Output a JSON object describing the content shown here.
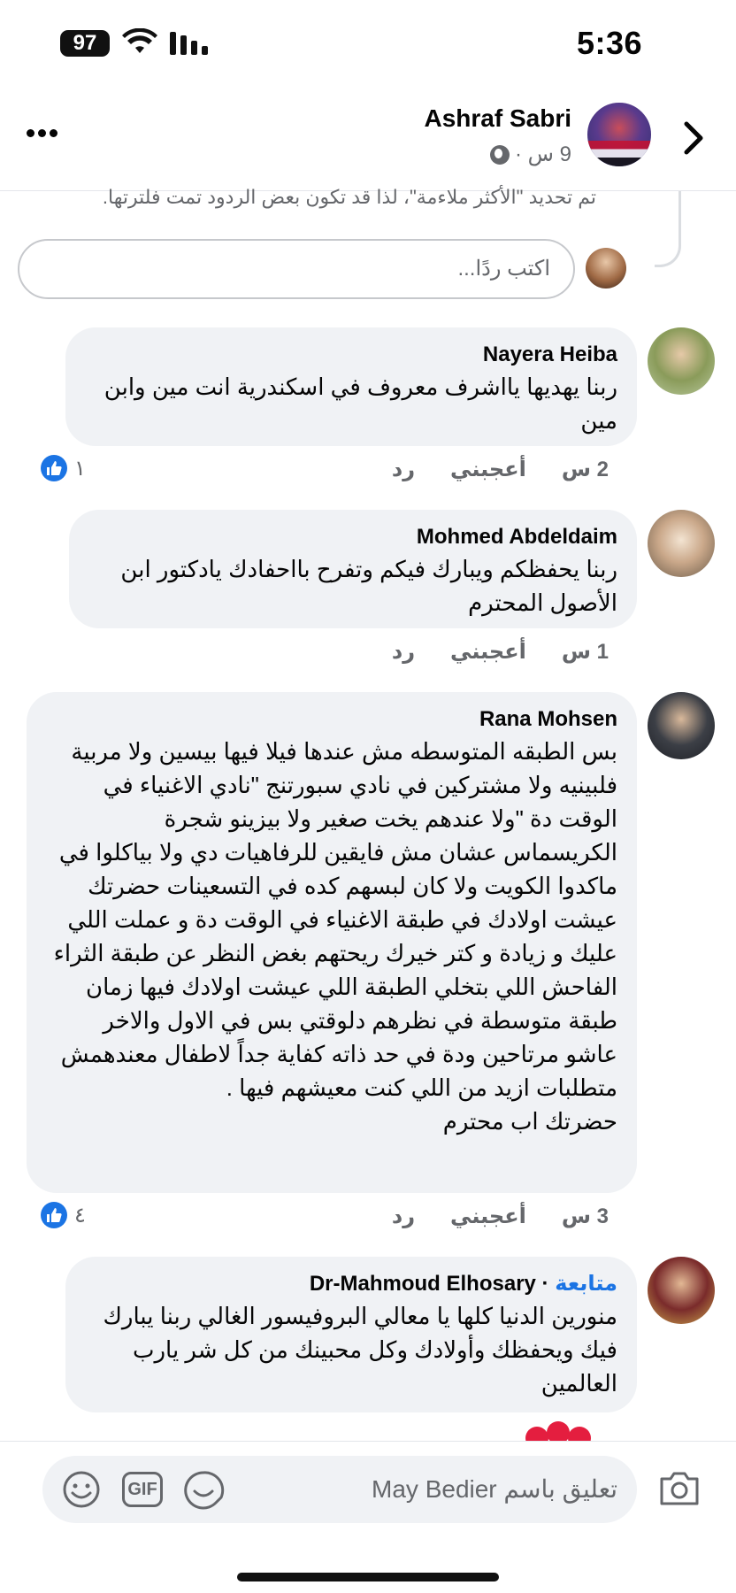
{
  "status_bar": {
    "time": "5:36",
    "battery": "97"
  },
  "header": {
    "name": "Ashraf Sabri",
    "meta": "9 س ·"
  },
  "thread": {
    "filter_note": "تم تحديد \"الأكثر ملاءمة\"، لذا قد تكون بعض الردود تمت فلترتها.",
    "reply_placeholder": "اكتب ردًا..."
  },
  "comments": [
    {
      "author": "Nayera Heiba",
      "text": "ربنا يهديها يااشرف معروف في اسكندرية انت مين وابن مين",
      "time": "2 س",
      "like_label": "أعجبني",
      "reply_label": "رد",
      "reactions": "١"
    },
    {
      "author": "Mohmed Abdeldaim",
      "text": "ربنا يحفظكم ويبارك فيكم وتفرح بااحفادك يادكتور ابن الأصول المحترم",
      "time": "1 س",
      "like_label": "أعجبني",
      "reply_label": "رد",
      "reactions": ""
    },
    {
      "author": "Rana Mohsen",
      "text": "بس الطبقه المتوسطه مش عندها فيلا فيها بيسين ولا مربية فلبينيه ولا مشتركين في نادي سبورتنج \"نادي الاغنياء في الوقت دة \"ولا  عندهم يخت صغير ولا بيزينو شجرة الكريسماس عشان مش فايقين للرفاهيات دي  ولا بياكلوا في ماكدوا الكويت ولا كان لبسهم كده في التسعينات حضرتك عيشت اولادك في طبقة الاغنياء في الوقت دة و عملت اللي عليك و زيادة و كتر خيرك ريحتهم بغض النظر عن طبقة الثراء الفاحش اللي بتخلي الطبقة اللي عيشت اولادك فيها زمان طبقة متوسطة في نظرهم دلوقتي بس في الاول والاخر عاشو مرتاحين ودة في حد ذاته كفاية جداً لاطفال معندهمش متطلبات ازيد من اللي كنت معيشهم فيها .\nحضرتك اب محترم",
      "time": "3 س",
      "like_label": "أعجبني",
      "reply_label": "رد",
      "reactions": "٤"
    },
    {
      "author": "Dr-Mahmoud Elhosary",
      "follow_label": "متابعة",
      "text": "منورين الدنيا كلها يا معالي البروفيسور الغالي ربنا يبارك فيك ويحفظك وأولادك وكل محبينك من كل شر يارب العالمين"
    }
  ],
  "composer": {
    "placeholder": "تعليق باسم May Bedier",
    "gif_label": "GIF"
  },
  "colors": {
    "accent": "#1b74e4",
    "bubble": "#f0f2f5",
    "secondary_text": "#65676b"
  }
}
